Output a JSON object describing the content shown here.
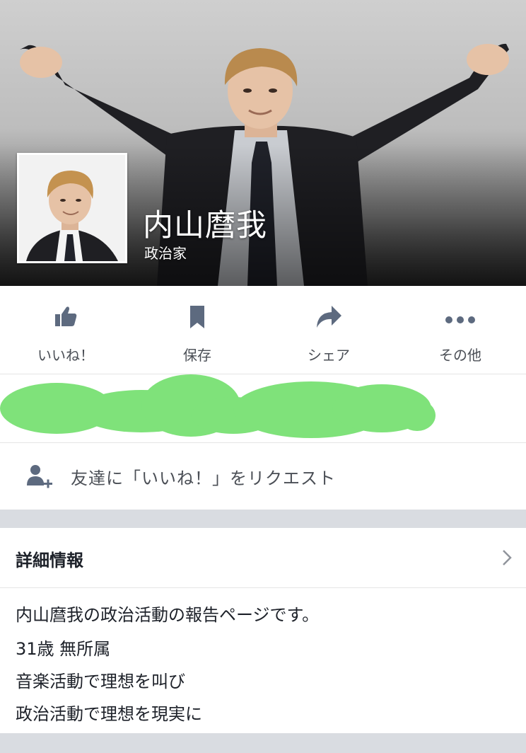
{
  "profile": {
    "name": "内山麿我",
    "category": "政治家"
  },
  "actions": [
    {
      "label": "いいね！",
      "icon": "thumbs-up-icon"
    },
    {
      "label": "保存",
      "icon": "bookmark-icon"
    },
    {
      "label": "シェア",
      "icon": "share-icon"
    },
    {
      "label": "その他",
      "icon": "more-icon"
    }
  ],
  "invite": {
    "label": "友達に「いいね！」をリクエスト",
    "icon": "add-friend-icon"
  },
  "details": {
    "title": "詳細情報",
    "lines": [
      "内山麿我の政治活動の報告ページです。",
      "31歳 無所属",
      "音楽活動で理想を叫び",
      "政治活動で理想を現実に"
    ]
  },
  "colors": {
    "icon_gray": "#5d6a7f",
    "label_gray": "#4b4f56",
    "redaction_green": "#7fe27a",
    "divider": "#d9dce1"
  }
}
